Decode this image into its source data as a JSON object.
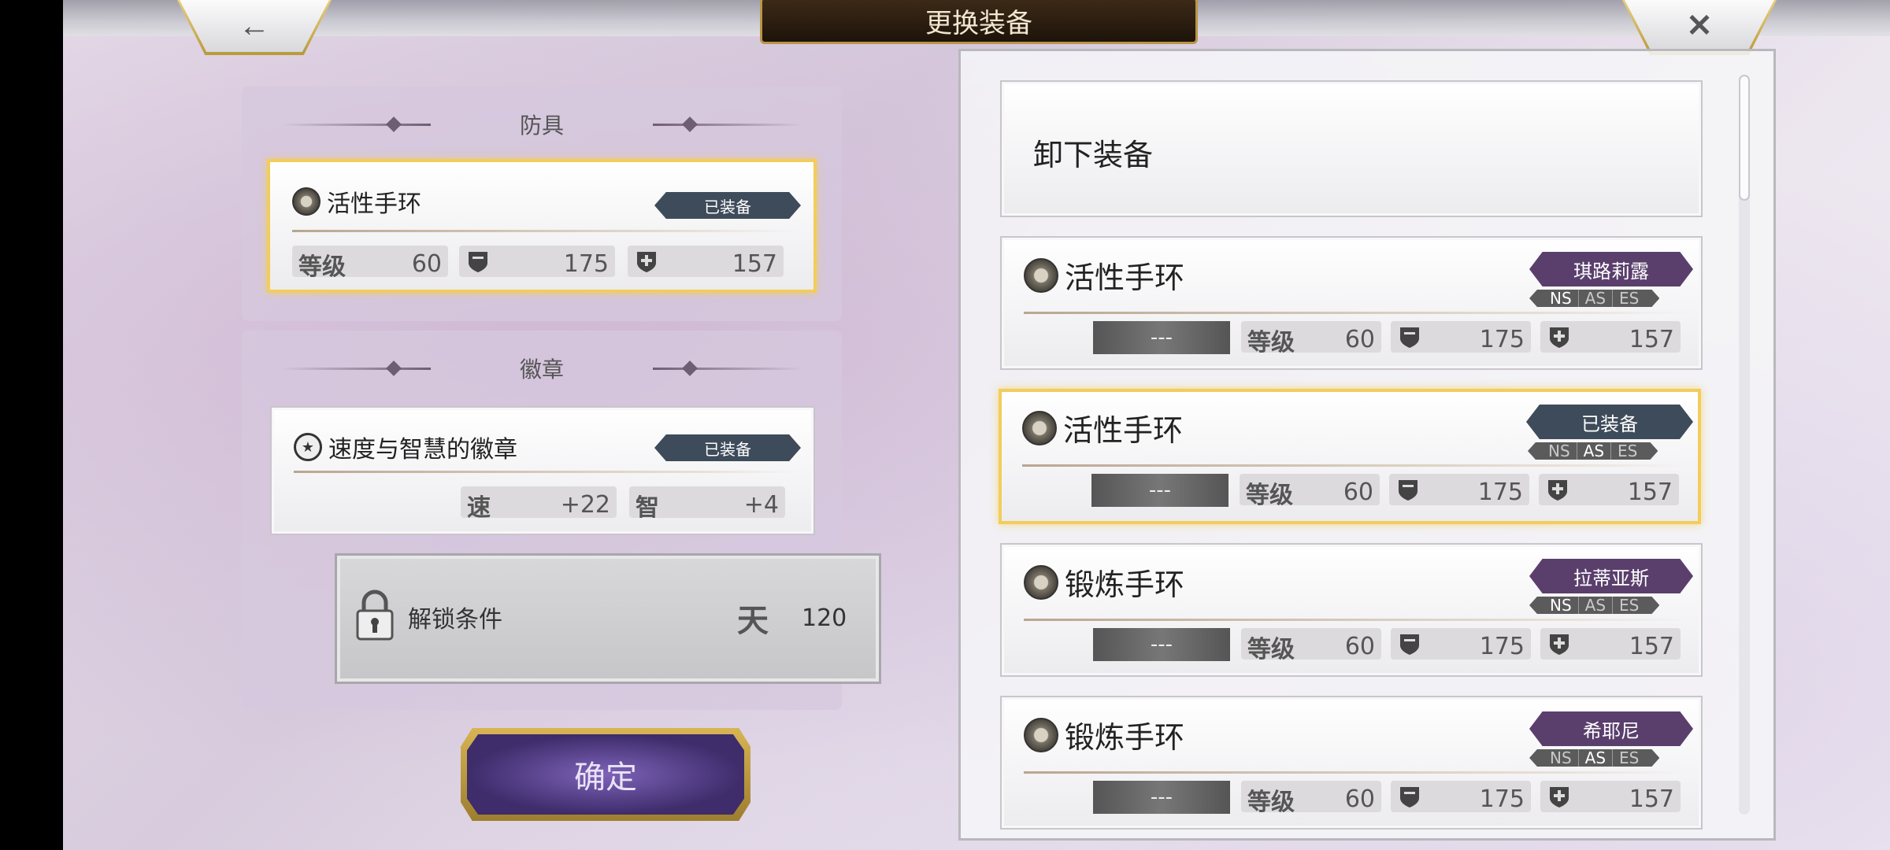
{
  "header": {
    "title": "更换装备",
    "back_icon": "arrow-left-icon",
    "close_icon": "close-icon"
  },
  "left": {
    "armor_section": {
      "title": "防具",
      "item": {
        "name": "活性手环",
        "status": "已装备",
        "level_label": "等级",
        "level": "60",
        "def": "175",
        "mdef": "157"
      }
    },
    "badge_section": {
      "title": "徽章",
      "item": {
        "name": "速度与智慧的徽章",
        "status": "已装备",
        "stat1_label": "速",
        "stat1": "+22",
        "stat2_label": "智",
        "stat2": "+4"
      },
      "locked": {
        "label": "解锁条件",
        "req_glyph": "天",
        "req_value": "120"
      }
    },
    "confirm_label": "确定"
  },
  "right": {
    "unequip_label": "卸下装备",
    "items": [
      {
        "name": "活性手环",
        "owner": "琪路莉露",
        "ns": [
          "NS",
          "AS",
          "ES"
        ],
        "active": "NS",
        "dash": "---",
        "level_label": "等级",
        "level": "60",
        "def": "175",
        "mdef": "157"
      },
      {
        "name": "活性手环",
        "owner": "已装备",
        "ns": [
          "NS",
          "AS",
          "ES"
        ],
        "active": "AS",
        "dash": "---",
        "level_label": "等级",
        "level": "60",
        "def": "175",
        "mdef": "157"
      },
      {
        "name": "锻炼手环",
        "owner": "拉蒂亚斯",
        "ns": [
          "NS",
          "AS",
          "ES"
        ],
        "active": "NS",
        "dash": "---",
        "level_label": "等级",
        "level": "60",
        "def": "175",
        "mdef": "157"
      },
      {
        "name": "锻炼手环",
        "owner": "希耶尼",
        "ns": [
          "NS",
          "AS",
          "ES"
        ],
        "active": "AS",
        "dash": "---",
        "level_label": "等级",
        "level": "60",
        "def": "175",
        "mdef": "157"
      }
    ]
  }
}
